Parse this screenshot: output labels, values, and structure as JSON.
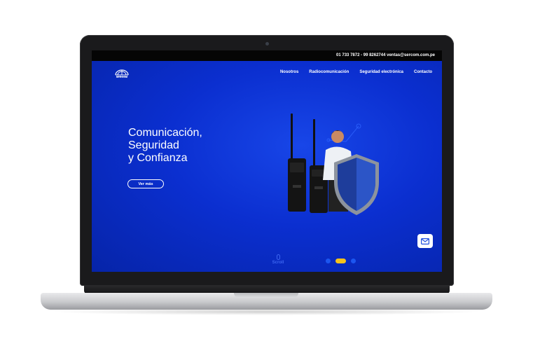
{
  "topbar": {
    "contact": "01 733 7872 - 99 8262744   ventas@sercom.com.pe"
  },
  "brand": {
    "logo_text": "SERCOM"
  },
  "nav": {
    "items": [
      "Nosotros",
      "Radiocomunicación",
      "Seguridad electrónica",
      "Contacto"
    ]
  },
  "hero": {
    "headline": [
      "Comunicación,",
      "Seguridad",
      "y Confianza"
    ],
    "cta_label": "Ver más"
  },
  "scroll": {
    "label": "Scroll"
  },
  "slider": {
    "total": 3,
    "active_index": 1
  },
  "colors": {
    "primary_blue": "#0a32c8",
    "accent_yellow": "#f7c21a",
    "topbar": "#050505"
  },
  "icons": {
    "mail": "envelope-icon",
    "mouse": "mouse-icon"
  }
}
